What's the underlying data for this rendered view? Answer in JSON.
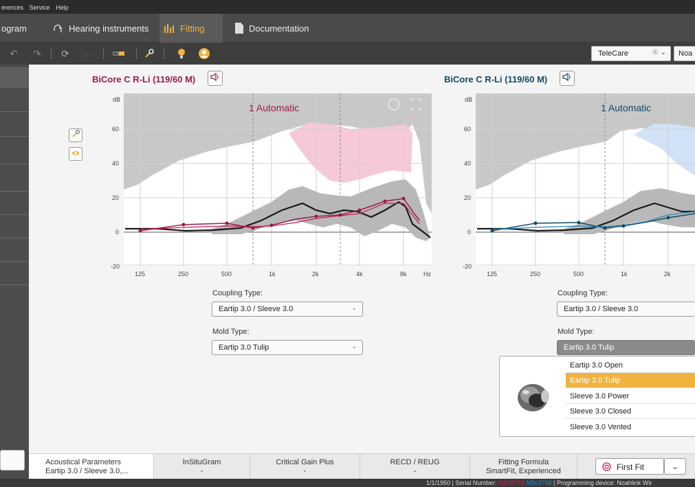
{
  "menu": [
    "erences",
    "Service",
    "Help"
  ],
  "tabs": [
    {
      "label": "ogram",
      "icon": "program-icon"
    },
    {
      "label": "Hearing instruments",
      "icon": "hearing-instrument-icon"
    },
    {
      "label": "Fitting",
      "icon": "fitting-bars-icon",
      "active": true
    },
    {
      "label": "Documentation",
      "icon": "document-icon"
    }
  ],
  "toolbar": {
    "telecare_label": "TeleCare",
    "noah_label": "Noa"
  },
  "left_device": {
    "title": "BiCore C R-Li (119/60 M)",
    "program_label": "1 Automatic",
    "coupling_label": "Coupling Type:",
    "coupling_value": "Eartip 3.0 / Sleeve 3.0",
    "mold_label": "Mold Type:",
    "mold_value": "Eartip 3.0 Tulip"
  },
  "right_device": {
    "title": "BiCore C R-Li (119/60 M)",
    "program_label": "1 Automatic",
    "coupling_label": "Coupling Type:",
    "coupling_value": "Eartip 3.0 / Sleeve 3.0",
    "mold_label": "Mold Type:",
    "mold_value": "Eartip 3.0 Tulip"
  },
  "dropdown_options": [
    "Eartip 3.0 Open",
    "Eartip 3.0 Tulip",
    "Sleeve 3.0 Power",
    "Sleeve 3.0 Closed",
    "Sleeve 3.0 Vented"
  ],
  "dropdown_selected": "Eartip 3.0 Tulip",
  "chart_data": [
    {
      "type": "line",
      "title": "1 Automatic",
      "ylabel": "dB",
      "xlabel": "Hz",
      "x_ticks": [
        "125",
        "250",
        "500",
        "1k",
        "2k",
        "4k",
        "8k"
      ],
      "y_ticks": [
        -20,
        0,
        20,
        40,
        60
      ],
      "ylim": [
        -20,
        80
      ],
      "grid": true
    },
    {
      "type": "line",
      "title": "1 Automatic",
      "ylabel": "dB",
      "x_ticks": [
        "125",
        "250",
        "500",
        "1k",
        "2k"
      ],
      "y_ticks": [
        -20,
        0,
        20,
        40,
        60
      ],
      "ylim": [
        -20,
        80
      ],
      "grid": true
    }
  ],
  "bottom_tabs": [
    {
      "title": "Acoustical Parameters",
      "sub": "Eartip 3.0 / Sleeve 3.0,..."
    },
    {
      "title": "InSituGram",
      "sub": "-"
    },
    {
      "title": "Critical Gain Plus",
      "sub": "-"
    },
    {
      "title": "RECD / REUG",
      "sub": "-"
    },
    {
      "title": "Fitting Formula",
      "sub": "SmartFit, Experienced"
    }
  ],
  "first_fit_label": "First Fit",
  "status": {
    "date": "1/1/1950",
    "serial_prefix": "Serial Number:",
    "serial_left": "ABK8793",
    "serial_right": "ABK8798",
    "programming": "Programming device: Noahlink Wir"
  },
  "colors": {
    "left_accent": "#9b1b4a",
    "right_accent": "#134a63",
    "active_tab": "#f0b340"
  }
}
